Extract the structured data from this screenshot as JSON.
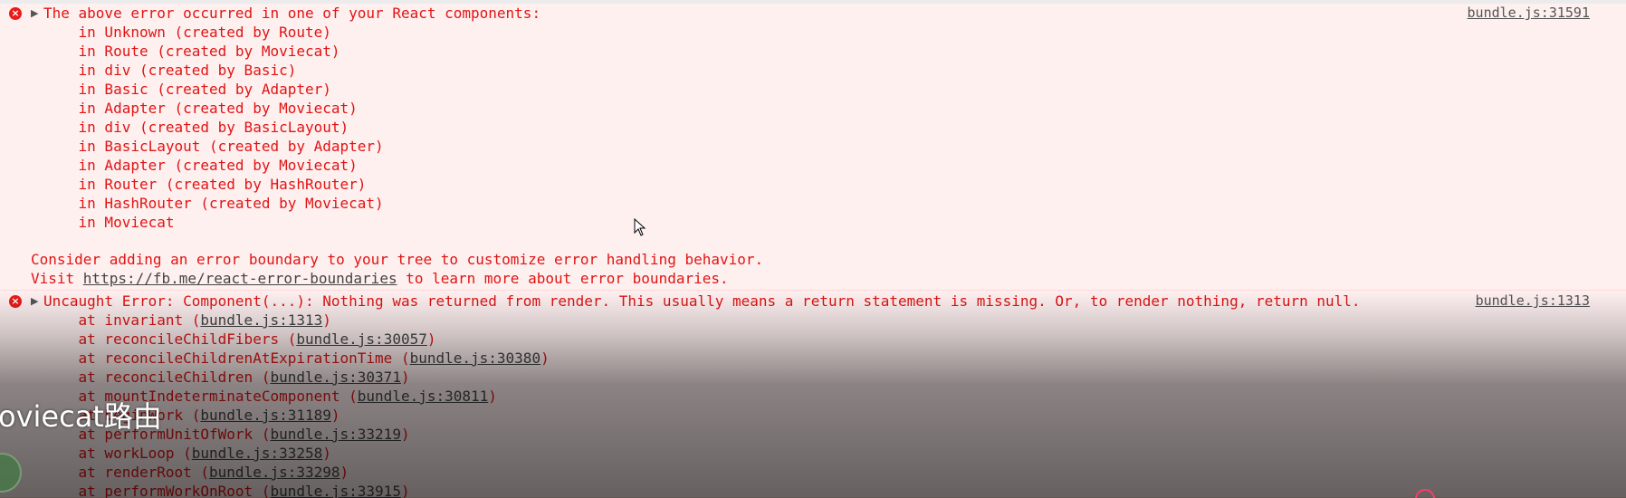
{
  "messages": [
    {
      "icon": "error-circle-icon",
      "summary": "The above error occurred in one of your React components:",
      "source": "bundle.js:31591",
      "stack": [
        "    in Unknown (created by Route)",
        "    in Route (created by Moviecat)",
        "    in div (created by Basic)",
        "    in Basic (created by Adapter)",
        "    in Adapter (created by Moviecat)",
        "    in div (created by BasicLayout)",
        "    in BasicLayout (created by Adapter)",
        "    in Adapter (created by Moviecat)",
        "    in Router (created by HashRouter)",
        "    in HashRouter (created by Moviecat)",
        "    in Moviecat"
      ],
      "advice": "Consider adding an error boundary to your tree to customize error handling behavior.",
      "visit_prefix": "Visit ",
      "visit_link": "https://fb.me/react-error-boundaries",
      "visit_suffix": " to learn more about error boundaries."
    },
    {
      "icon": "error-circle-icon",
      "summary": "Uncaught Error: Component(...): Nothing was returned from render. This usually means a return statement is missing. Or, to render nothing, return null.",
      "source": "bundle.js:1313",
      "frames": [
        {
          "prefix": "    at invariant (",
          "link": "bundle.js:1313",
          "suffix": ")"
        },
        {
          "prefix": "    at reconcileChildFibers (",
          "link": "bundle.js:30057",
          "suffix": ")"
        },
        {
          "prefix": "    at reconcileChildrenAtExpirationTime (",
          "link": "bundle.js:30380",
          "suffix": ")"
        },
        {
          "prefix": "    at reconcileChildren (",
          "link": "bundle.js:30371",
          "suffix": ")"
        },
        {
          "prefix": "    at mountIndeterminateComponent (",
          "link": "bundle.js:30811",
          "suffix": ")"
        },
        {
          "prefix": "    at beginWork (",
          "link": "bundle.js:31189",
          "suffix": ")"
        },
        {
          "prefix": "    at performUnitOfWork (",
          "link": "bundle.js:33219",
          "suffix": ")"
        },
        {
          "prefix": "    at workLoop (",
          "link": "bundle.js:33258",
          "suffix": ")"
        },
        {
          "prefix": "    at renderRoot (",
          "link": "bundle.js:33298",
          "suffix": ")"
        },
        {
          "prefix": "    at performWorkOnRoot (",
          "link": "bundle.js:33915",
          "suffix": ")"
        }
      ]
    }
  ],
  "overlay": {
    "watermark_text": "oviecat路由"
  },
  "colors": {
    "error_text": "#e01414",
    "error_bg": "#fff0f0",
    "link": "#545454"
  }
}
